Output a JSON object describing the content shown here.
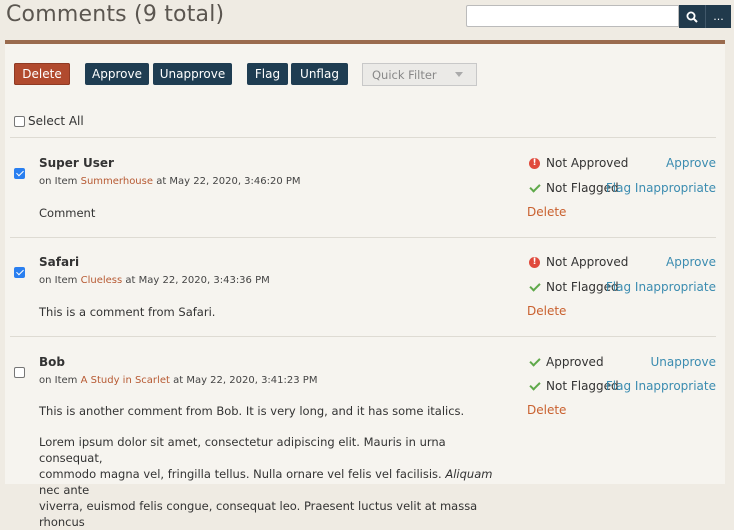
{
  "header": {
    "title": "Comments (9 total)",
    "search_value": "",
    "more_label": "..."
  },
  "toolbar": {
    "delete_label": "Delete",
    "approve_label": "Approve",
    "unapprove_label": "Unapprove",
    "flag_label": "Flag",
    "unflag_label": "Unflag",
    "quick_filter_label": "Quick Filter"
  },
  "select_all_label": "Select All",
  "comments": [
    {
      "author": "Super User",
      "meta_prefix": "on Item",
      "item_title": "Summerhouse",
      "meta_suffix": "at May 22, 2020, 3:46:20 PM",
      "body": "Comment",
      "checked": true,
      "approval_status": "Not Approved",
      "approval_action": "Approve",
      "flag_status": "Not Flagged",
      "flag_action": "Flag Inappropriate",
      "delete_label": "Delete"
    },
    {
      "author": "Safari",
      "meta_prefix": "on Item",
      "item_title": "Clueless",
      "meta_suffix": "at May 22, 2020, 3:43:36 PM",
      "body": "This is a comment from Safari.",
      "checked": true,
      "approval_status": "Not Approved",
      "approval_action": "Approve",
      "flag_status": "Not Flagged",
      "flag_action": "Flag Inappropriate",
      "delete_label": "Delete"
    },
    {
      "author": "Bob",
      "meta_prefix": "on Item",
      "item_title": "A Study in Scarlet",
      "meta_suffix": "at May 22, 2020, 3:41:23 PM",
      "body": "This is another comment from Bob. It is very long, and it has some italics.",
      "body_p2_line1": "Lorem ipsum dolor sit amet, consectetur adipiscing elit. Mauris in urna consequat,",
      "body_p2_line2": "commodo magna vel, fringilla tellus. Nulla ornare vel felis vel facilisis.",
      "body_p2_italic": "Aliquam",
      "body_p2_line2_tail": "nec ante",
      "body_p2_line3": "viverra, euismod felis congue, consequat leo. Praesent luctus velit at massa rhoncus",
      "checked": false,
      "approval_status": "Approved",
      "approval_action": "Unapprove",
      "flag_status": "Not Flagged",
      "flag_action": "Flag Inappropriate",
      "delete_label": "Delete"
    }
  ],
  "colors": {
    "accent_red": "#b14a2e",
    "navy": "#1f3d52",
    "link_blue": "#3b8cb0",
    "link_orange": "#c9602e",
    "approved_green": "#5fa94a",
    "alert_red": "#e04a3c"
  }
}
